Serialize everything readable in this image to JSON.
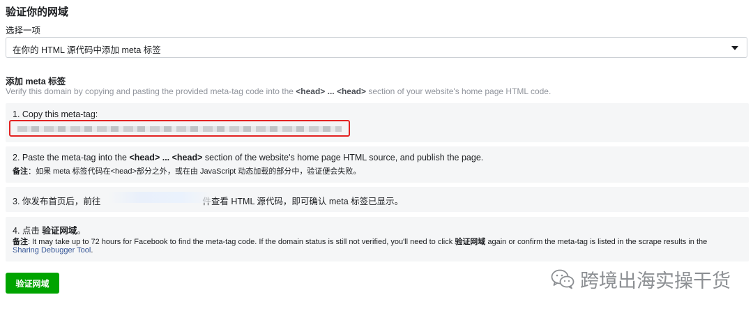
{
  "page": {
    "title": "验证你的网域",
    "select_label": "选择一项",
    "select_value": "在你的 HTML 源代码中添加 meta 标签",
    "section_title": "添加 meta 标签",
    "section_desc_prefix": "Verify this domain by copying and pasting the provided meta-tag code into the ",
    "section_desc_head1": "<head>",
    "section_desc_mid": " ... ",
    "section_desc_head2": "<head>",
    "section_desc_suffix": " section of your website's home page HTML code."
  },
  "steps": {
    "s1": {
      "head": "1. Copy this meta-tag:"
    },
    "s2": {
      "head_prefix": "2. Paste the meta-tag into the ",
      "head_bold": "<head> ... <head>",
      "head_suffix": " section of the website's home page HTML source, and publish the page.",
      "note_label": "备注",
      "note_text": "：如果 meta 标签代码在<head>部分之外，或在由 JavaScript 动态加载的部分中，验证便会失败。"
    },
    "s3": {
      "head_prefix": "3. 你发布首页后，前往",
      "head_suffix": "件查看 HTML 源代码，即可确认 meta 标签已显示。"
    },
    "s4": {
      "head_prefix": "4. 点击 ",
      "head_bold": "验证网域",
      "head_suffix": "。",
      "note_label": "备注",
      "note_text_1": ": It may take up to 72 hours for Facebook to find the meta-tag code. If the domain status is still not verified, you'll need to click ",
      "note_bold": "验证网域",
      "note_text_2": " again or confirm the meta-tag is listed in the scrape results in the",
      "note_link": "Sharing Debugger Tool",
      "note_end": "."
    }
  },
  "button": {
    "label": "验证网域"
  },
  "watermark": {
    "text": "跨境出海实操干货",
    "icon": "wechat-icon"
  },
  "colors": {
    "accent": "#00a400",
    "highlight_border": "#e32222",
    "link": "#385898",
    "muted": "#90949c"
  }
}
